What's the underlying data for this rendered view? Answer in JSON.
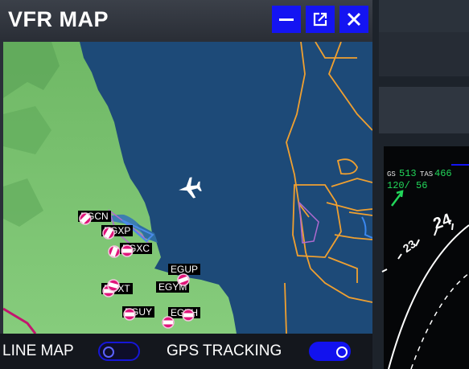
{
  "window": {
    "title": "VFR MAP",
    "buttons": {
      "minimize": "minimize-icon",
      "popout": "popout-icon",
      "close": "close-icon"
    },
    "accent": "#1414f2"
  },
  "map": {
    "aircraft_icon": "airplane-icon",
    "colors": {
      "sea": "#1d4a78",
      "land": "#7cc67a",
      "airspace": "#f0a030",
      "airport": "#e0157a"
    },
    "airports": [
      {
        "id": "EGCN"
      },
      {
        "id": "EGXP"
      },
      {
        "id": "EGXC"
      },
      {
        "id": "EGUP"
      },
      {
        "id": "EGYM"
      },
      {
        "id": "EGXT"
      },
      {
        "id": "EGUY"
      },
      {
        "id": "EGXH"
      }
    ]
  },
  "controls": {
    "line_map": {
      "label": "LINE MAP",
      "enabled": false
    },
    "gps_tracking": {
      "label": "GPS TRACKING",
      "enabled": true
    }
  },
  "background_display": {
    "gs_label": "GS",
    "gs_value": "513",
    "tas_label": "TAS",
    "tas_value": "466",
    "wind": "120/ 56",
    "compass_marks": [
      "23",
      "24"
    ]
  }
}
